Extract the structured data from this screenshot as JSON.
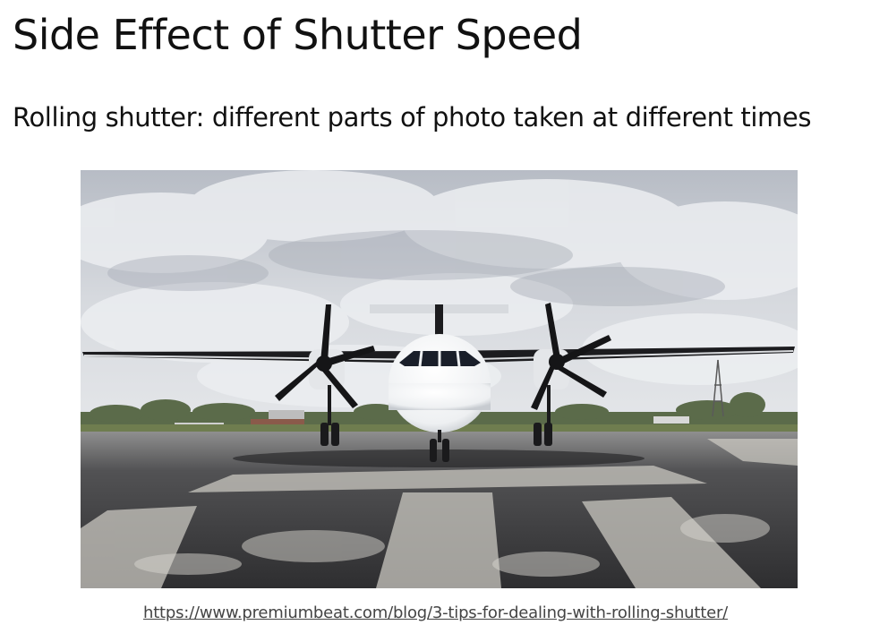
{
  "slide": {
    "title": "Side Effect of Shutter Speed",
    "subtitle": "Rolling shutter: different parts of photo taken at different times",
    "source_link": "https://www.premiumbeat.com/blog/3-tips-for-dealing-with-rolling-shutter/"
  },
  "photo": {
    "subject": "turboprop-airplane-on-tarmac"
  },
  "colors": {
    "text": "#111111",
    "link": "#444444",
    "sky": "#c9ced6",
    "tarmac": "#3a3a3c",
    "fuselage": "#ffffff"
  }
}
